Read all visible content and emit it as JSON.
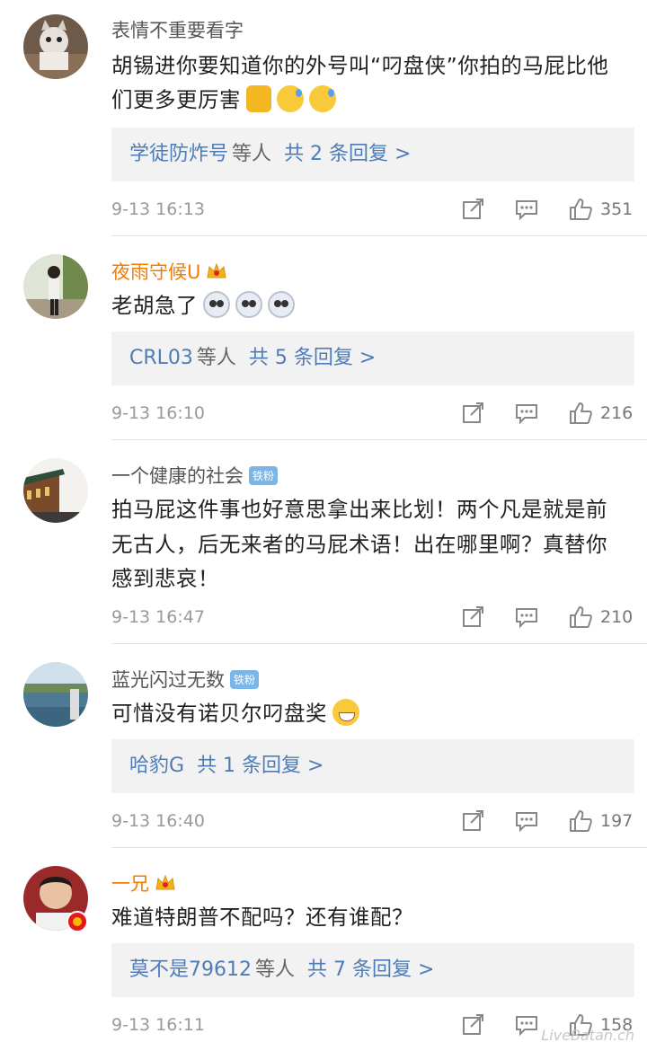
{
  "comments": [
    {
      "name": "表情不重要看字",
      "text": "胡锡进你要知道你的外号叫“叼盘侠”你拍的马屁比他们更多更厉害",
      "reply_users": "学徒防炸号",
      "reply_suffix": "等人",
      "reply_count": "共 2 条回复 >",
      "time": "9-13 16:13",
      "likes": "351"
    },
    {
      "name": "夜雨守候U",
      "text": "老胡急了",
      "reply_users": "CRL03",
      "reply_suffix": "等人",
      "reply_count": "共 5 条回复 >",
      "time": "9-13 16:10",
      "likes": "216"
    },
    {
      "name": "一个健康的社会",
      "badge": "铁粉",
      "text": "拍马屁这件事也好意思拿出来比划！两个凡是就是前无古人，后无来者的马屁术语！出在哪里啊？真替你感到悲哀！",
      "time": "9-13 16:47",
      "likes": "210"
    },
    {
      "name": "蓝光闪过无数",
      "badge": "铁粉",
      "text": "可惜没有诺贝尔叼盘奖",
      "reply_users": "哈豹G",
      "reply_count": "共 1 条回复 >",
      "time": "9-13 16:40",
      "likes": "197"
    },
    {
      "name": "一兄",
      "text": "难道特朗普不配吗？还有谁配？",
      "reply_users": "莫不是79612",
      "reply_suffix": "等人",
      "reply_count": "共 7 条回复 >",
      "time": "9-13 16:11",
      "likes": "158"
    }
  ],
  "watermark": "LiveBatan.ch",
  "icons": {
    "share": "share-icon",
    "comment": "comment-icon",
    "like": "thumbs-up-icon",
    "crown": "crown-icon"
  },
  "colors": {
    "link": "#4e7cb8",
    "vip_name": "#f27b00",
    "badge": "#7bb6e8"
  }
}
